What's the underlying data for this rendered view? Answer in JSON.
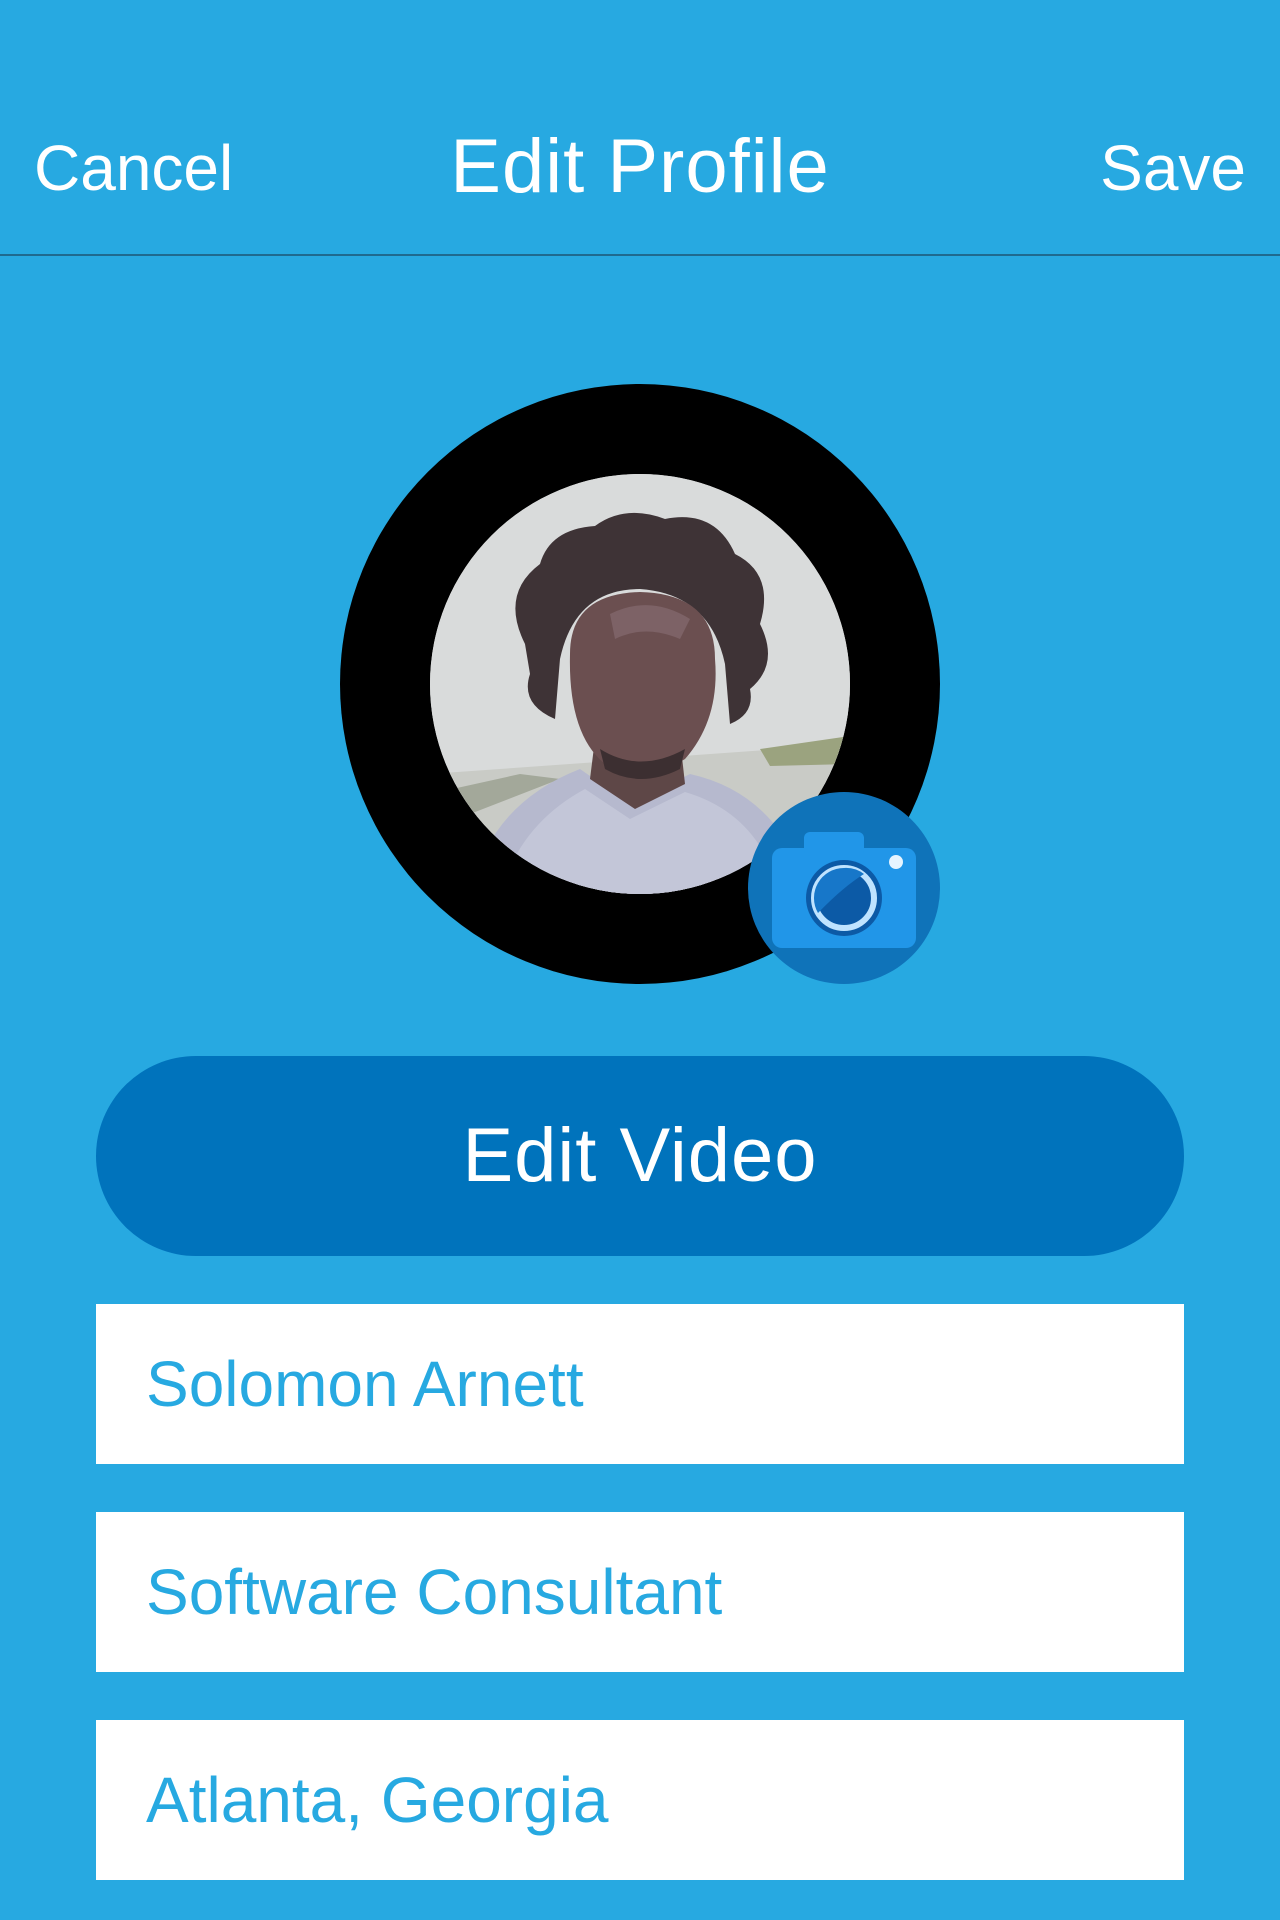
{
  "nav": {
    "cancel_label": "Cancel",
    "title": "Edit Profile",
    "save_label": "Save"
  },
  "avatar": {
    "camera_icon": "camera-icon"
  },
  "actions": {
    "edit_video_label": "Edit Video"
  },
  "fields": {
    "name": "Solomon Arnett",
    "title": "Software Consultant",
    "location": "Atlanta, Georgia"
  },
  "colors": {
    "background": "#27a9e1",
    "button": "#0073bc",
    "camera_badge": "#0f73b9",
    "field_text": "#27a9e1",
    "ring": "#000000"
  }
}
